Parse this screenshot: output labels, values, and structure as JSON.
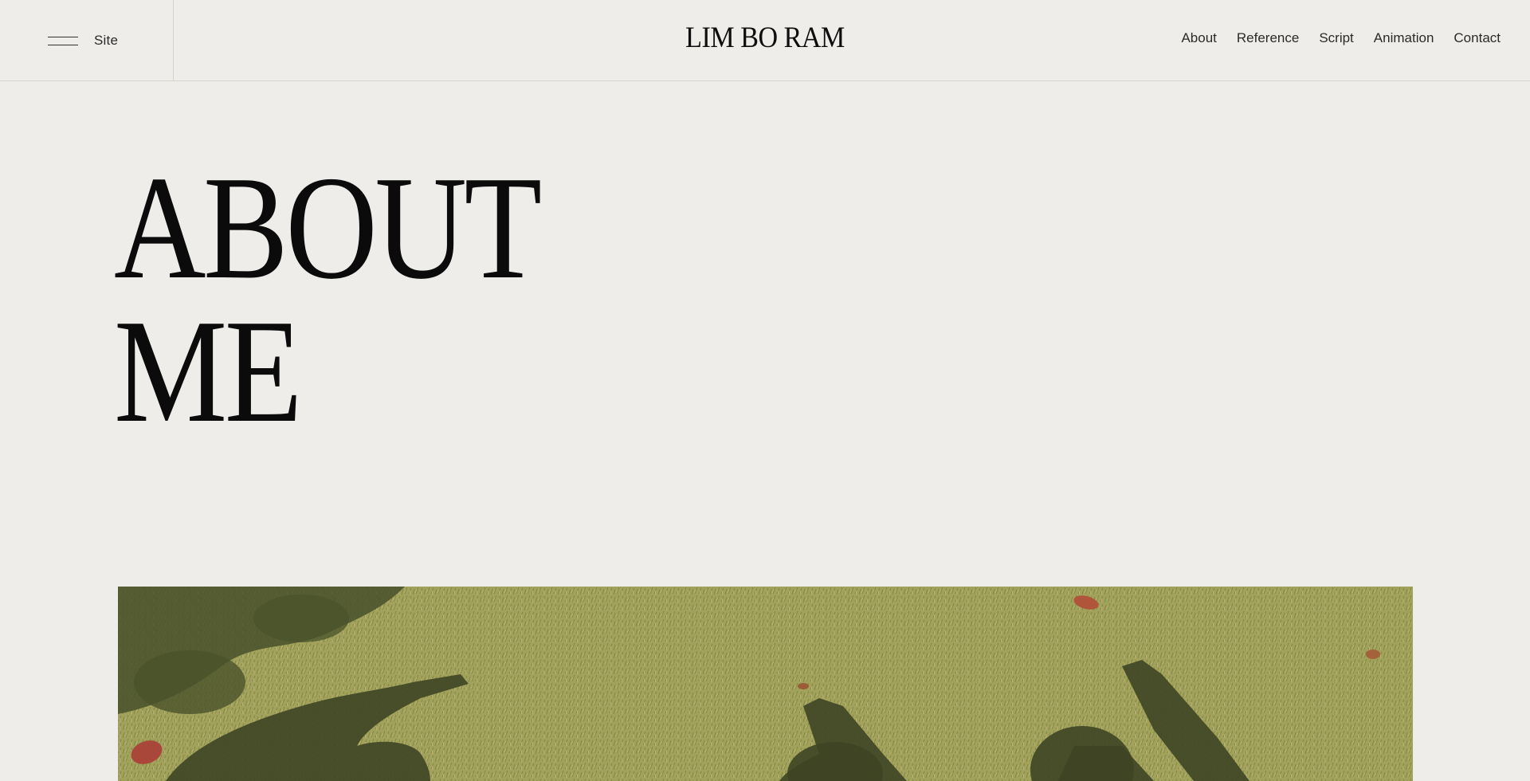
{
  "header": {
    "site_menu": {
      "icon": "hamburger-menu-icon",
      "label": "Site"
    },
    "logo": "LIM BO RAM",
    "nav": [
      {
        "label": "About"
      },
      {
        "label": "Reference"
      },
      {
        "label": "Script"
      },
      {
        "label": "Animation"
      },
      {
        "label": "Contact"
      }
    ]
  },
  "hero": {
    "title_line_1": "ABOUT",
    "title_line_2": "ME"
  },
  "photo": {
    "alt": "shadows of people waving on grass"
  },
  "colors": {
    "background": "#efedea",
    "divider": "#d6d3ce",
    "text": "#1a1a1a",
    "grass": "#9a9a55",
    "shadow": "#3e4523"
  }
}
